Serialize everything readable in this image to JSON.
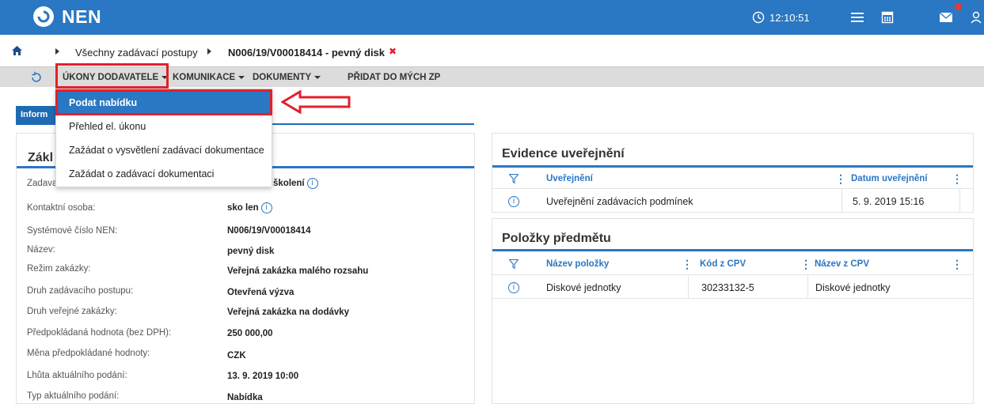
{
  "header": {
    "brand": "NEN",
    "clock": "12:10:51",
    "icons": [
      "clock-icon",
      "menu-icon",
      "calculator-icon",
      "mail-icon",
      "user-icon"
    ],
    "accent": "#2a77c3",
    "notification_color": "#e53935"
  },
  "breadcrumb": {
    "home_icon": "home-icon",
    "items": [
      "Všechny zadávací postupy",
      "N006/19/V00018414 - pevný disk"
    ],
    "close_symbol": "✖"
  },
  "toolbar": {
    "refresh_icon": "refresh-icon",
    "items": [
      "ÚKONY DODAVATELE",
      "KOMUNIKACE",
      "DOKUMENTY",
      "PŘIDAT DO MÝCH ZP"
    ]
  },
  "dropdown": {
    "items": [
      "Podat nabídku",
      "Přehled el. úkonu",
      "Zažádat o vysvětlení zadávací dokumentace",
      "Zažádat o zadávací dokumentaci"
    ],
    "active_index": 0,
    "highlight_color": "#e3202a"
  },
  "tab": {
    "label": "Inform"
  },
  "basic_panel": {
    "title": "Zákl",
    "rows": [
      {
        "label": "Zadava",
        "value": "školení",
        "info": "i"
      },
      {
        "label": "Kontaktní osoba:",
        "value": "sko len",
        "info": "i"
      },
      {
        "label": "Systémové číslo NEN:",
        "value": "N006/19/V00018414"
      },
      {
        "label": "Název:",
        "value": "pevný disk"
      },
      {
        "label": "Režim zakázky:",
        "value": "Veřejná zakázka malého rozsahu"
      },
      {
        "label": "Druh zadávacího postupu:",
        "value": "Otevřená výzva"
      },
      {
        "label": "Druh veřejné zakázky:",
        "value": "Veřejná zakázka na dodávky"
      },
      {
        "label": "Předpokládaná hodnota (bez DPH):",
        "value": "250 000,00"
      },
      {
        "label": "Měna předpokládané hodnoty:",
        "value": "CZK"
      },
      {
        "label": "Lhůta aktuálního podání:",
        "value": "13. 9. 2019 10:00"
      },
      {
        "label": "Typ aktuálního podání:",
        "value": "Nabídka"
      }
    ]
  },
  "evidence_panel": {
    "title": "Evidence uveřejnění",
    "columns": [
      "Uveřejnění",
      "Datum uveřejnění"
    ],
    "rows": [
      {
        "name": "Uveřejnění zadávacích podmínek",
        "date": "5. 9. 2019 15:16"
      }
    ]
  },
  "items_panel": {
    "title": "Položky předmětu",
    "columns": [
      "Název položky",
      "Kód z CPV",
      "Název z CPV"
    ],
    "rows": [
      {
        "name": "Diskové jednotky",
        "cpv_code": "30233132-5",
        "cpv_name": "Diskové jednotky"
      }
    ]
  },
  "common": {
    "info_glyph": "i",
    "more_glyph": "⋮"
  }
}
